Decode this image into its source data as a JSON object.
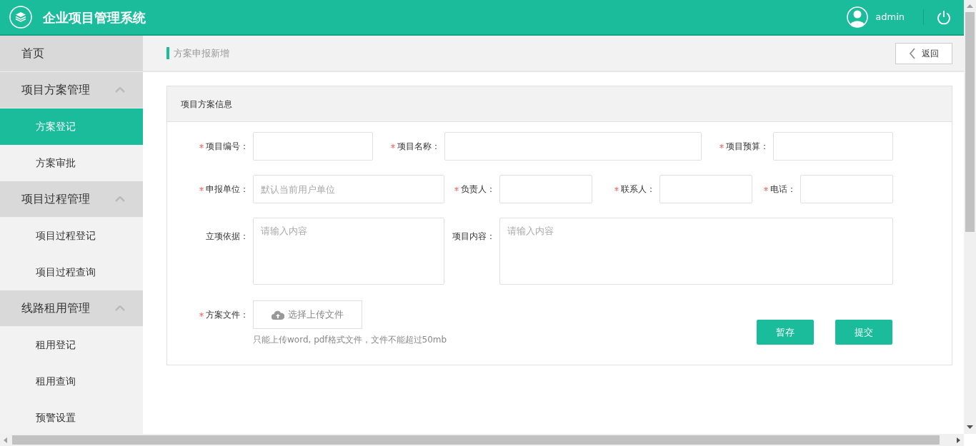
{
  "header": {
    "title": "企业项目管理系统",
    "user": "admin"
  },
  "sidebar": {
    "items": [
      {
        "kind": "link",
        "label": "首页",
        "selected": false
      },
      {
        "kind": "group",
        "label": "项目方案管理",
        "expanded": true,
        "children": [
          {
            "label": "方案登记",
            "selected": true
          },
          {
            "label": "方案审批",
            "selected": false
          }
        ]
      },
      {
        "kind": "group",
        "label": "项目过程管理",
        "expanded": true,
        "children": [
          {
            "label": "项目过程登记",
            "selected": false
          },
          {
            "label": "项目过程查询",
            "selected": false
          }
        ]
      },
      {
        "kind": "group",
        "label": "线路租用管理",
        "expanded": true,
        "children": [
          {
            "label": "租用登记",
            "selected": false
          },
          {
            "label": "租用查询",
            "selected": false
          },
          {
            "label": "预警设置",
            "selected": false
          }
        ]
      }
    ]
  },
  "breadcrumb": "方案申报新增",
  "back_button": "返回",
  "form": {
    "title": "项目方案信息",
    "rows": [
      [
        {
          "label": "项目编号：",
          "required": true,
          "kind": "input"
        },
        {
          "label": "项目名称：",
          "required": true,
          "kind": "input"
        },
        {
          "label": "项目预算：",
          "required": true,
          "kind": "input"
        }
      ],
      [
        {
          "label": "申报单位：",
          "required": true,
          "kind": "input",
          "placeholder": "默认当前用户单位"
        },
        {
          "label": "负责人：",
          "required": true,
          "kind": "input"
        },
        {
          "label": "联系人：",
          "required": true,
          "kind": "input"
        },
        {
          "label": "电话：",
          "required": true,
          "kind": "input"
        }
      ],
      [
        {
          "label": "立项依据：",
          "required": false,
          "kind": "textarea",
          "placeholder": "请输入内容"
        },
        {
          "label": "项目内容：",
          "required": false,
          "kind": "textarea",
          "placeholder": "请输入内容"
        }
      ]
    ],
    "upload": {
      "label": "方案文件：",
      "required": true,
      "button": "选择上传文件",
      "hint": "只能上传word, pdf格式文件，文件不能超过50mb"
    },
    "buttons": [
      "暂存",
      "提交"
    ]
  }
}
